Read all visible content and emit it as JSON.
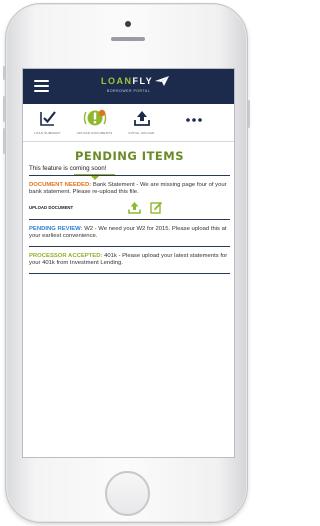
{
  "app": {
    "logo_text_main": "LOAN",
    "logo_text_accent": "FLY",
    "logo_subtitle": "BORROWER PORTAL"
  },
  "tabs": [
    {
      "label": "LOAN SUMMARY",
      "icon": "checklist-icon"
    },
    {
      "label": "UPLOAD DOCUMENTS",
      "icon": "document-alert-icon",
      "badge": "9"
    },
    {
      "label": "INITIAL UPLOAD",
      "icon": "upload-icon"
    },
    {
      "label": "",
      "icon": "more-icon"
    }
  ],
  "page": {
    "title": "PENDING ITEMS",
    "subtitle": "This feature is coming soon!"
  },
  "items": [
    {
      "label": "DOCUMENT NEEDED:",
      "text": " Bank Statement - We are missing page four of your bank statement. Please re-upload this file."
    },
    {
      "label": "PENDING REVIEW:",
      "text": " W2 - We need your W2 for 2015. Please upload this at your earliest convenience."
    },
    {
      "label": "PROCESSOR ACCEPTED:",
      "text": " 401k - Please upload your latest statements for your 401k from Investment Lending."
    }
  ],
  "upload": {
    "label": "UPLOAD DOCUMENT"
  },
  "colors": {
    "header_bg": "#1c2b4b",
    "accent_green": "#8fb82c",
    "label_orange": "#e3721b",
    "label_blue": "#2f7fd1"
  }
}
